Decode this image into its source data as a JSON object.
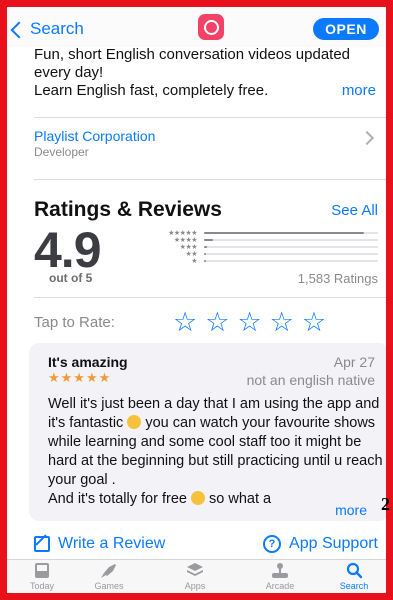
{
  "nav": {
    "back_label": "Search",
    "open_label": "OPEN"
  },
  "description": {
    "lines": [
      "Fun, short English conversation videos updated",
      "every day!",
      "Learn English fast, completely free."
    ],
    "more_label": "more"
  },
  "developer": {
    "name": "Playlist Corporation",
    "role": "Developer"
  },
  "ratings": {
    "title": "Ratings & Reviews",
    "see_all": "See All",
    "average": "4.9",
    "out_of": "out of 5",
    "count": "1,583 Ratings",
    "distribution": [
      0.92,
      0.05,
      0.02,
      0.01,
      0.01
    ]
  },
  "tap_to_rate": {
    "label": "Tap to Rate:",
    "star_glyph": "☆"
  },
  "review": {
    "title": "It's amazing",
    "date": "Apr 27",
    "stars": "★★★★★",
    "author": "not an english native",
    "body_1": "Well it's just been a day that I am using the app and it's fantastic",
    "body_2": "you can watch your favourite shows while learning and some cool staff too it might be hard at the beginning but still practicing until u reach your goal .",
    "body_3": "And it's totally for free",
    "body_4": "so what a",
    "more_label": "more"
  },
  "page_number": "2",
  "actions": {
    "write_review": "Write a Review",
    "app_support": "App Support"
  },
  "tabs": [
    {
      "label": "Today",
      "icon": "today-icon"
    },
    {
      "label": "Games",
      "icon": "rocket-icon"
    },
    {
      "label": "Apps",
      "icon": "apps-stack-icon"
    },
    {
      "label": "Arcade",
      "icon": "joystick-icon"
    },
    {
      "label": "Search",
      "icon": "search-icon"
    }
  ],
  "colors": {
    "accent": "#0a7aff",
    "border": "#e8101b",
    "star": "#f09a37",
    "app_icon": "#f24268"
  }
}
